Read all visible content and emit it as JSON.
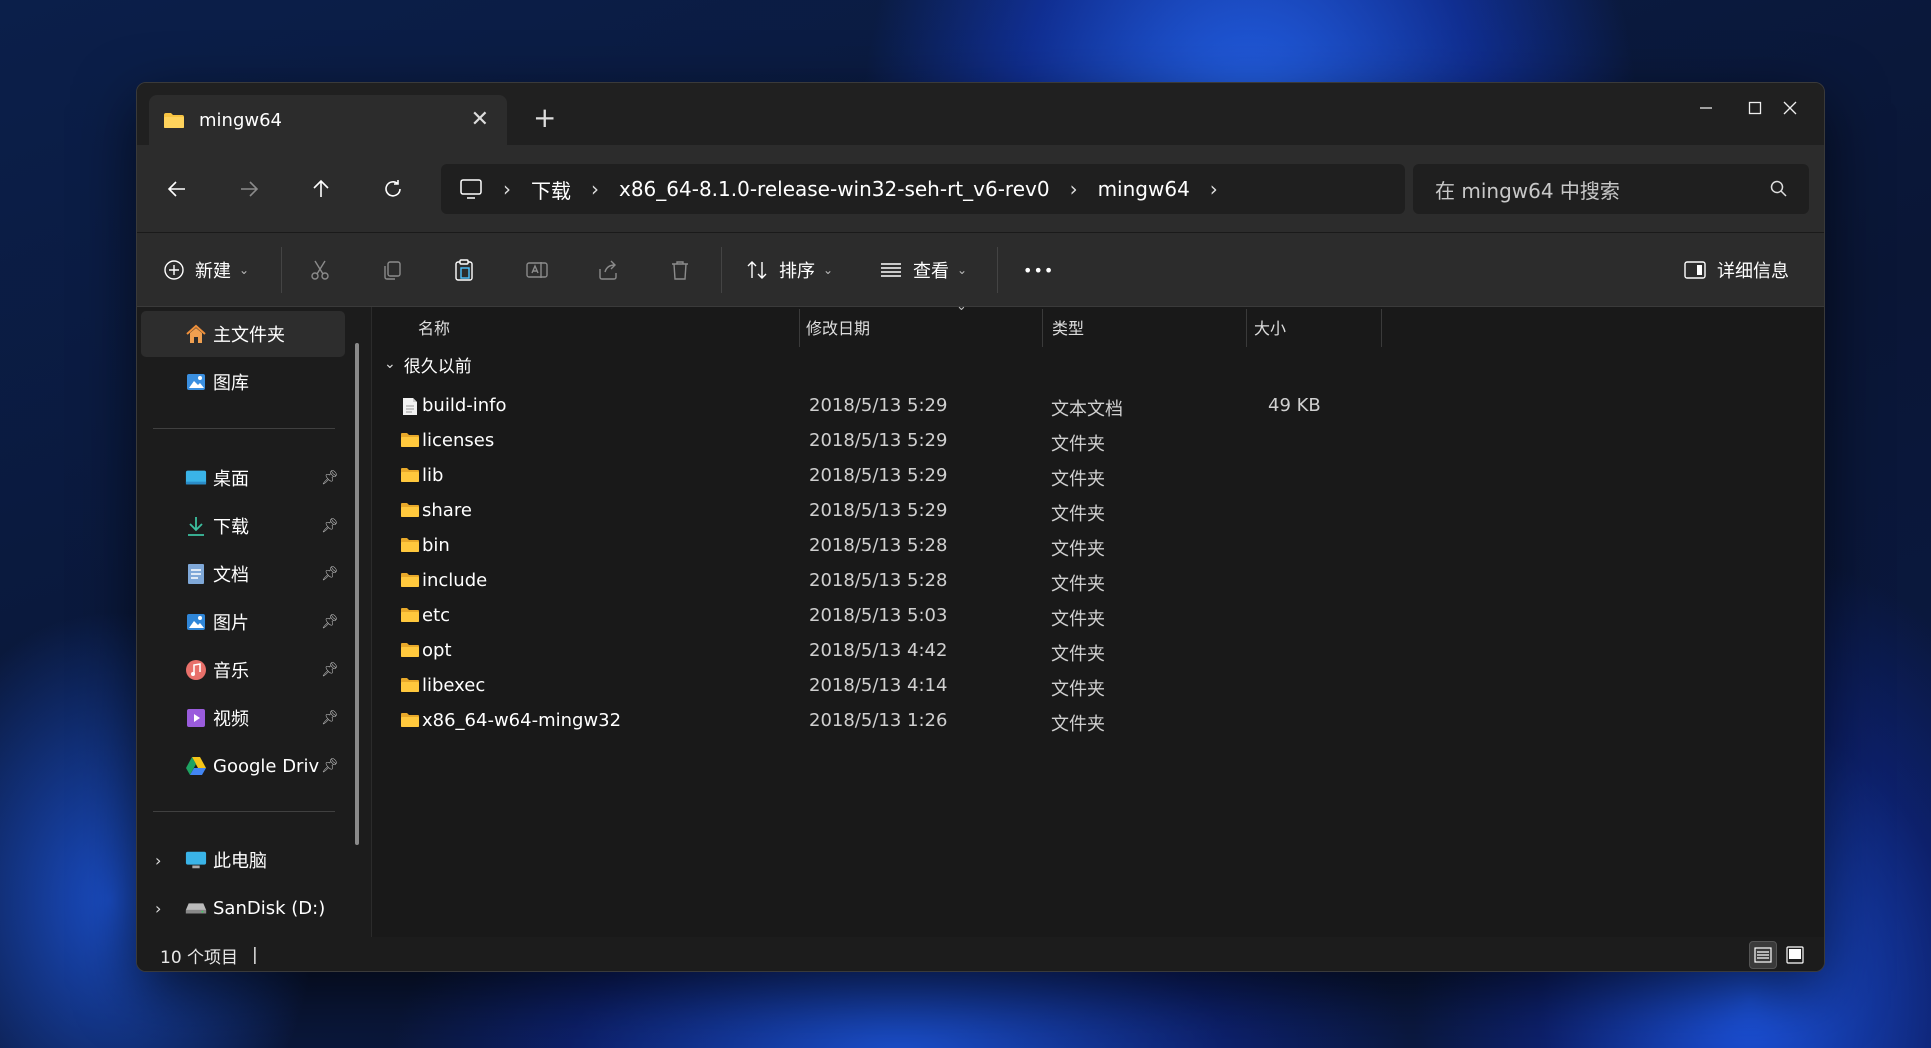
{
  "window": {
    "tab_title": "mingw64",
    "tab_close": "✕",
    "new_tab": "+"
  },
  "breadcrumb": {
    "items": [
      "下载",
      "x86_64-8.1.0-release-win32-seh-rt_v6-rev0",
      "mingw64"
    ],
    "separator": "›"
  },
  "search": {
    "placeholder": "在 mingw64 中搜索"
  },
  "toolbar": {
    "new_label": "新建",
    "sort_label": "排序",
    "view_label": "查看",
    "more_label": "•••",
    "details_label": "详细信息"
  },
  "sidebar": {
    "items": [
      {
        "label": "主文件夹",
        "icon": "home-icon",
        "active": true
      },
      {
        "label": "图库",
        "icon": "gallery-icon"
      },
      {
        "label": "桌面",
        "icon": "desktop-icon",
        "pinned": true
      },
      {
        "label": "下载",
        "icon": "download-icon",
        "pinned": true
      },
      {
        "label": "文档",
        "icon": "document-icon",
        "pinned": true
      },
      {
        "label": "图片",
        "icon": "pictures-icon",
        "pinned": true
      },
      {
        "label": "音乐",
        "icon": "music-icon",
        "pinned": true
      },
      {
        "label": "视频",
        "icon": "video-icon",
        "pinned": true
      },
      {
        "label": "Google Driv",
        "icon": "google-drive-icon",
        "pinned": true
      },
      {
        "label": "此电脑",
        "icon": "this-pc-icon"
      },
      {
        "label": "SanDisk (D:)",
        "icon": "drive-icon"
      }
    ]
  },
  "columns": {
    "name": "名称",
    "date": "修改日期",
    "type": "类型",
    "size": "大小"
  },
  "group": {
    "label": "很久以前"
  },
  "files": [
    {
      "name": "build-info",
      "date": "2018/5/13 5:29",
      "type": "文本文档",
      "size": "49 KB",
      "icon": "text-file-icon"
    },
    {
      "name": "licenses",
      "date": "2018/5/13 5:29",
      "type": "文件夹",
      "size": "",
      "icon": "folder-icon"
    },
    {
      "name": "lib",
      "date": "2018/5/13 5:29",
      "type": "文件夹",
      "size": "",
      "icon": "folder-icon"
    },
    {
      "name": "share",
      "date": "2018/5/13 5:29",
      "type": "文件夹",
      "size": "",
      "icon": "folder-icon"
    },
    {
      "name": "bin",
      "date": "2018/5/13 5:28",
      "type": "文件夹",
      "size": "",
      "icon": "folder-icon"
    },
    {
      "name": "include",
      "date": "2018/5/13 5:28",
      "type": "文件夹",
      "size": "",
      "icon": "folder-icon"
    },
    {
      "name": "etc",
      "date": "2018/5/13 5:03",
      "type": "文件夹",
      "size": "",
      "icon": "folder-icon"
    },
    {
      "name": "opt",
      "date": "2018/5/13 4:42",
      "type": "文件夹",
      "size": "",
      "icon": "folder-icon"
    },
    {
      "name": "libexec",
      "date": "2018/5/13 4:14",
      "type": "文件夹",
      "size": "",
      "icon": "folder-icon"
    },
    {
      "name": "x86_64-w64-mingw32",
      "date": "2018/5/13 1:26",
      "type": "文件夹",
      "size": "",
      "icon": "folder-icon"
    }
  ],
  "status": {
    "item_count": "10 个项目",
    "cursor": "|"
  },
  "colors": {
    "folder": "#f8c442",
    "accent": "#4cc2ff",
    "window_bg": "#1c1c1c",
    "chrome_bg": "#2c2c2c"
  }
}
